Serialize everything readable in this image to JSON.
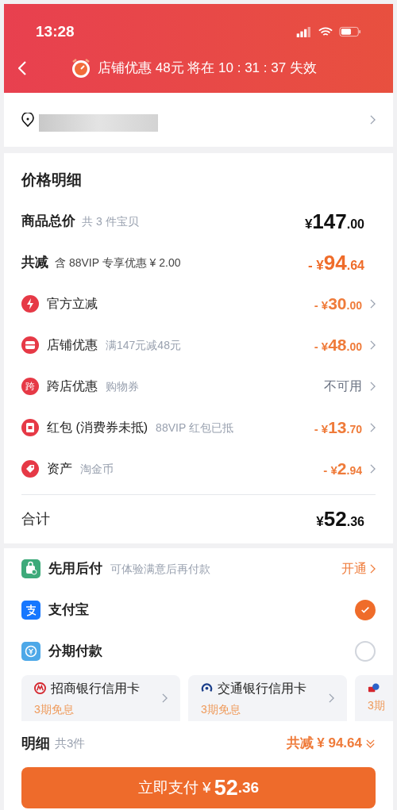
{
  "status_bar": {
    "time": "13:28"
  },
  "banner": {
    "text": "店铺优惠 48元 将在 10 : 31 : 37 失效"
  },
  "price_detail": {
    "title": "价格明细",
    "summary": [
      {
        "label": "商品总价",
        "note": "共 3 件宝贝",
        "amount": {
          "prefix": "¥",
          "int": "147",
          "dec": ".00"
        }
      },
      {
        "label": "共减",
        "note": "含 88VIP 专享优惠 ¥ 2.00",
        "amount": {
          "prefix": "- ¥",
          "int": "94",
          "dec": ".64"
        }
      }
    ],
    "items": [
      {
        "label": "官方立减",
        "amount": {
          "prefix": "- ¥",
          "int": "30",
          "dec": ".00"
        }
      },
      {
        "label": "店铺优惠",
        "note": "满147元减48元",
        "amount": {
          "prefix": "- ¥",
          "int": "48",
          "dec": ".00"
        }
      },
      {
        "badge": "跨",
        "label": "跨店优惠",
        "note": "购物券",
        "status": "不可用"
      },
      {
        "label": "红包 (消费券未抵)",
        "note": "88VIP 红包已抵",
        "amount": {
          "prefix": "- ¥",
          "int": "13",
          "dec": ".70"
        }
      },
      {
        "label": "资产",
        "note": "淘金币",
        "amount": {
          "prefix": "- ¥",
          "int": "2",
          "dec": ".94"
        }
      }
    ],
    "total": {
      "label": "合计",
      "amount": {
        "prefix": "¥",
        "int": "52",
        "dec": ".36"
      }
    }
  },
  "payment": {
    "methods": [
      {
        "kind": "action",
        "label": "先用后付",
        "note": "可体验满意后再付款",
        "action": "开通"
      },
      {
        "kind": "radio",
        "label": "支付宝",
        "selected": true
      },
      {
        "kind": "radio",
        "label": "分期付款",
        "selected": false
      }
    ],
    "cards": [
      {
        "name": "招商银行信用卡",
        "offer": "3期免息"
      },
      {
        "name": "交通银行信用卡",
        "offer": "3期免息"
      },
      {
        "offer": "3期"
      }
    ]
  },
  "footer": {
    "label": "明细",
    "count": "共3件",
    "saving": "共减 ¥ 94.64",
    "button": {
      "label": "立即支付 ¥",
      "int": "52",
      "dec": ".36"
    }
  }
}
